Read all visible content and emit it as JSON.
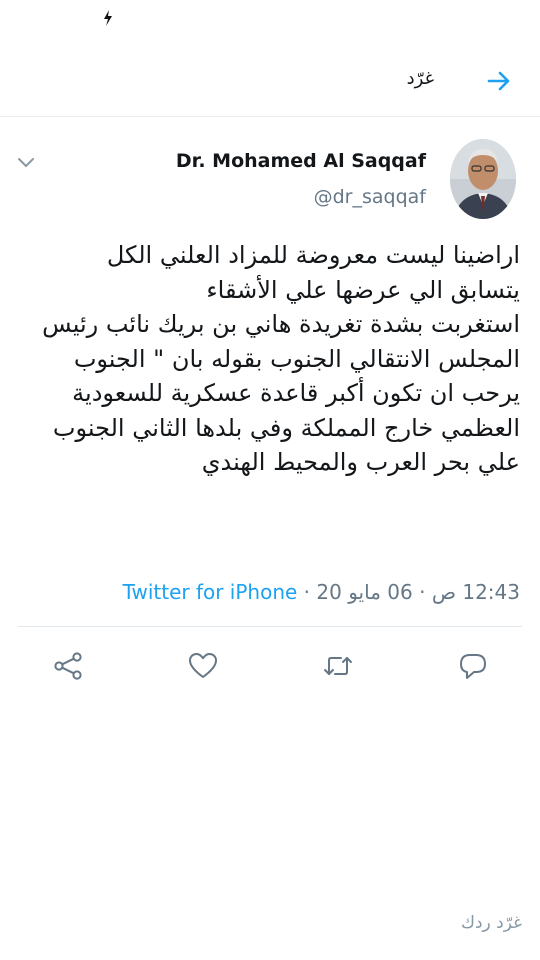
{
  "status_bar": {
    "icon": "flash-icon"
  },
  "header": {
    "title": "غرّد",
    "back_icon": "arrow-right-icon"
  },
  "tweet": {
    "author_name": "Dr. Mohamed Al Saqqaf",
    "author_handle": "@dr_saqqaf",
    "text": "اراضينا ليست معروضة للمزاد العلني الكل\nيتسابق الي عرضها علي الأشقاء\nاستغربت بشدة تغريدة هاني بن بريك نائب رئيس المجلس الانتقالي الجنوب بقوله بان \" الجنوب يرحب ان تكون أكبر قاعدة عسكرية للسعودية العظمي خارج المملكة وفي بلدها الثاني الجنوب علي بحر العرب والمحيط الهندي",
    "time": "12:43 ص",
    "date": "06 مايو 20",
    "separator": " · ",
    "source": "Twitter for iPhone"
  },
  "actions": [
    {
      "name": "share-icon"
    },
    {
      "name": "like-icon"
    },
    {
      "name": "retweet-icon"
    },
    {
      "name": "reply-icon"
    }
  ],
  "composer": {
    "placeholder": "غرّد ردك"
  },
  "colors": {
    "accent": "#1da1f2",
    "secondary_text": "#657786",
    "divider": "#e6ecf0"
  }
}
